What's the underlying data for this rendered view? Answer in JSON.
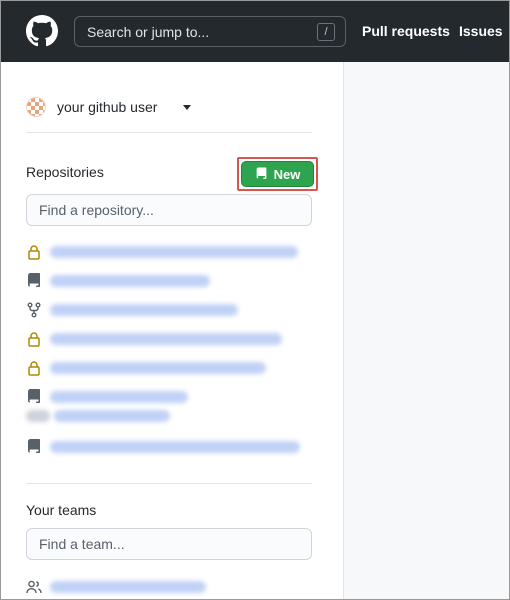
{
  "header": {
    "search_placeholder": "Search or jump to...",
    "slash_key": "/",
    "nav": [
      "Pull requests",
      "Issues"
    ]
  },
  "sidebar": {
    "user": {
      "name": "your github user"
    },
    "repositories": {
      "title": "Repositories",
      "new_label": "New",
      "search_placeholder": "Find a repository...",
      "items": [
        {
          "icon": "lock-icon"
        },
        {
          "icon": "repo-icon"
        },
        {
          "icon": "repo-forked-icon"
        },
        {
          "icon": "lock-icon"
        },
        {
          "icon": "lock-icon"
        },
        {
          "icon": "repo-icon"
        },
        {
          "icon": "repo-icon"
        }
      ]
    },
    "teams": {
      "title": "Your teams",
      "search_placeholder": "Find a team...",
      "items": [
        {
          "icon": "people-icon"
        }
      ]
    }
  },
  "colors": {
    "header_bg": "#24292e",
    "new_button": "#2ea44f",
    "highlight": "#d9534f",
    "private_icon": "#b08800"
  }
}
